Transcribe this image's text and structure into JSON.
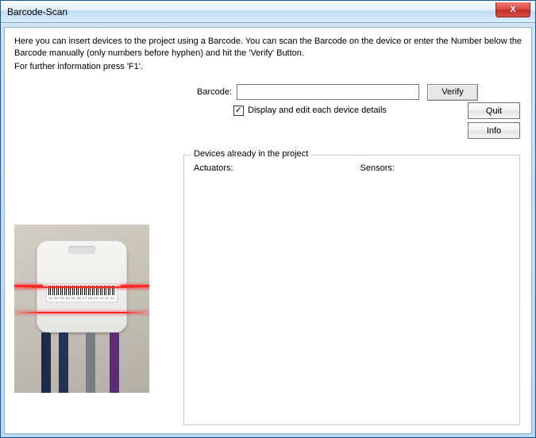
{
  "window": {
    "title": "Barcode-Scan"
  },
  "intro": {
    "line1": "Here you can insert devices to the project using a Barcode. You can scan the Barcode on the device or enter the Number below the Barcode manually (only numbers before hyphen) and hit the 'Verify' Button.",
    "line2": "For further information press 'F1'."
  },
  "form": {
    "barcode_label": "Barcode:",
    "barcode_value": "",
    "barcode_placeholder": "",
    "verify_label": "Verify",
    "display_edit_checked": true,
    "display_edit_label": "Display and edit each device details"
  },
  "side": {
    "quit_label": "Quit",
    "info_label": "Info"
  },
  "groupbox": {
    "title": "Devices already in the project",
    "actuators_label": "Actuators:",
    "sensors_label": "Sensors:"
  },
  "icons": {
    "close": "X",
    "check": "✓"
  }
}
